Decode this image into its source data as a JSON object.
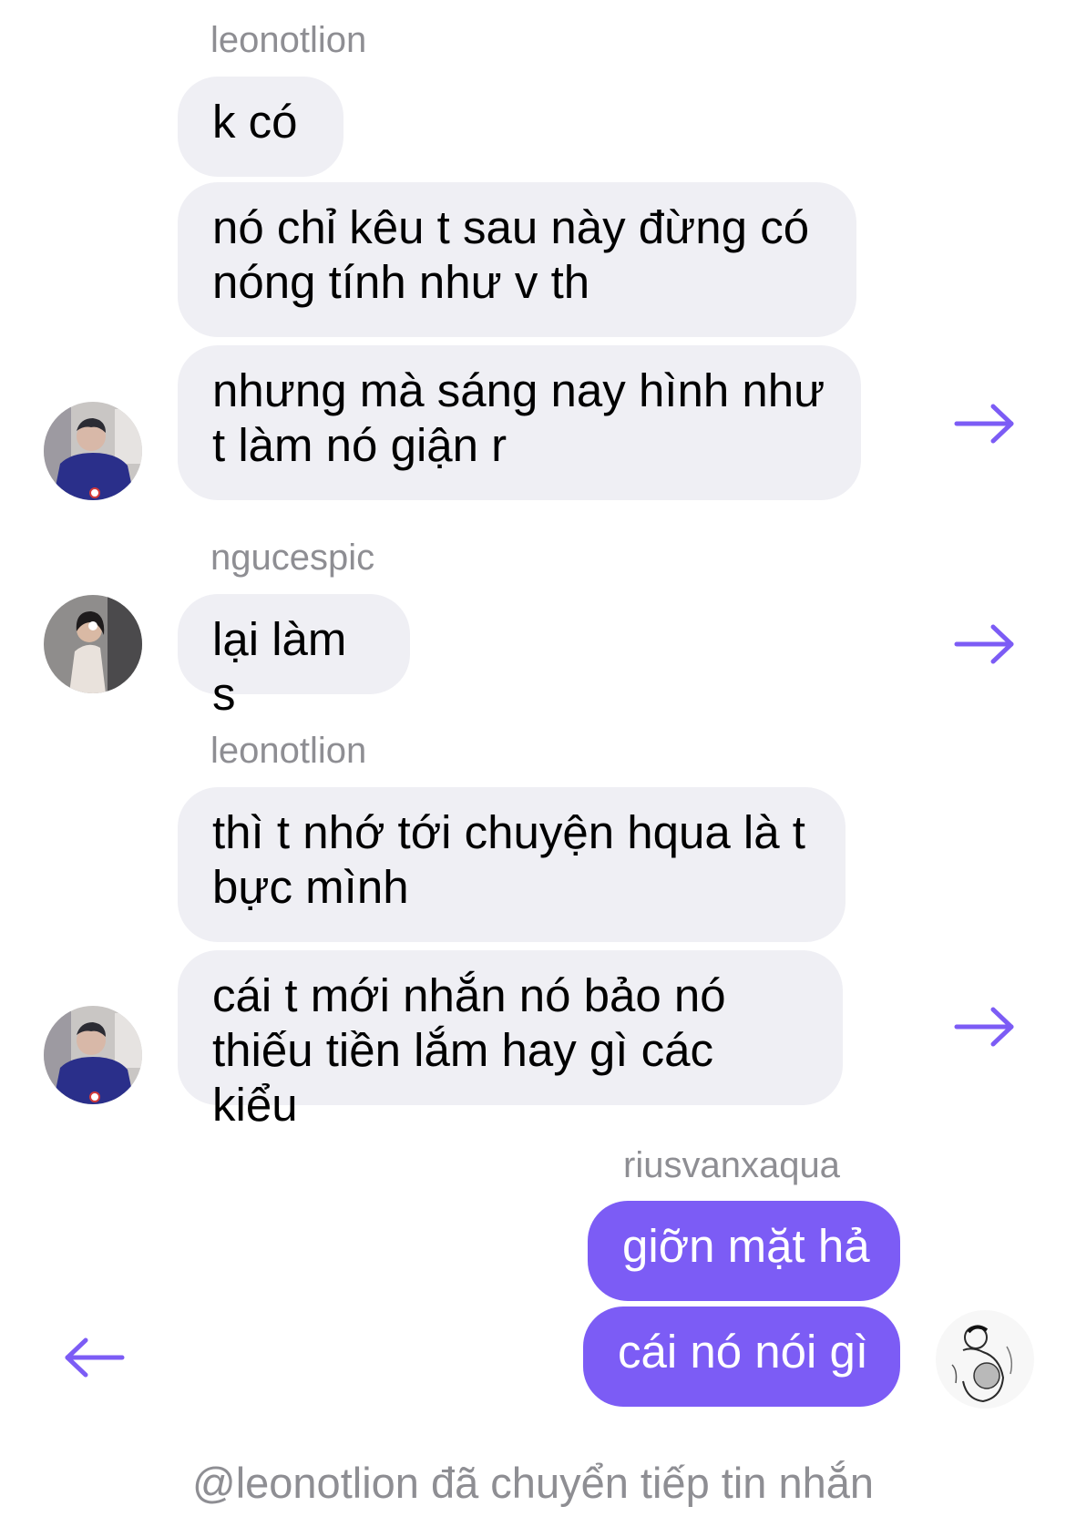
{
  "messages": {
    "group1": {
      "sender": "leonotlion",
      "bubbles": [
        "k có",
        "nó chỉ kêu t sau này đừng có\nnóng tính như v th",
        "nhưng mà sáng nay hình như\nt làm nó giận r"
      ]
    },
    "group2": {
      "sender": "ngucespic",
      "bubbles": [
        "lại làm s"
      ]
    },
    "group3": {
      "sender": "leonotlion",
      "bubbles": [
        "thì t nhớ tới chuyện hqua là t\nbực mình",
        "cái t mới nhắn nó bảo nó\nthiếu tiền lắm hay gì các kiểu"
      ]
    },
    "group4": {
      "sender": "riusvanxaqua",
      "bubbles": [
        "giỡn mặt hả",
        "cái nó nói gì"
      ]
    }
  },
  "footer": "@leonotlion đã chuyển tiếp tin nhắn",
  "colors": {
    "accent": "#7c5cf5",
    "incoming_bubble": "#efeff4",
    "meta_text": "#8e8e93"
  },
  "icons": {
    "forward": "arrow-right-icon",
    "back": "arrow-left-icon"
  }
}
